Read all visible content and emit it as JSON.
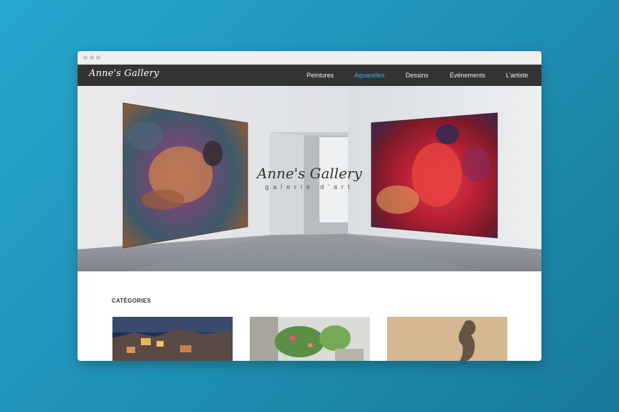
{
  "site": {
    "logo": "Anne's Gallery"
  },
  "nav": {
    "items": [
      {
        "label": "Peintures",
        "active": false
      },
      {
        "label": "Aquarelles",
        "active": true
      },
      {
        "label": "Dessins",
        "active": false
      },
      {
        "label": "Événements",
        "active": false
      },
      {
        "label": "L'artiste",
        "active": false
      }
    ]
  },
  "hero": {
    "title": "Anne's Gallery",
    "subtitle": "galerie d'art"
  },
  "categories": {
    "heading": "CATÉGORIES"
  },
  "colors": {
    "background": "#1f8fb4",
    "navbar": "#333333",
    "nav_active": "#3ab3d9"
  }
}
